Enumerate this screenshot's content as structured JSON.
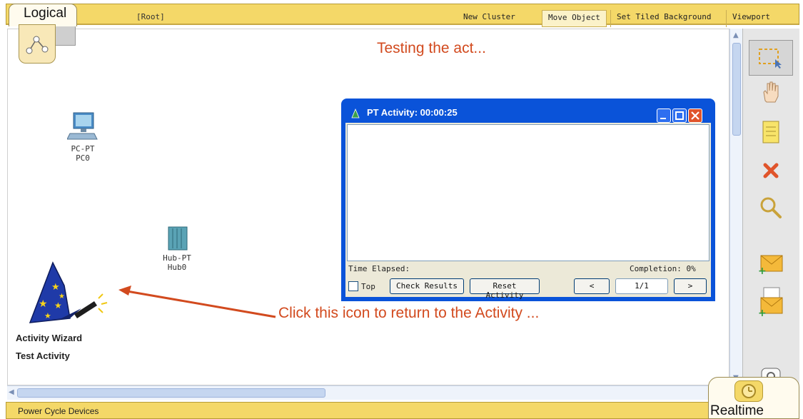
{
  "topbar": {
    "mode_tab": "Logical",
    "root": "[Root]",
    "buttons": [
      "New Cluster",
      "Move Object",
      "Set Tiled Background",
      "Viewport"
    ]
  },
  "canvas": {
    "title": "Testing the act...",
    "devices": [
      {
        "type": "PC-PT",
        "name": "PC0"
      },
      {
        "type": "Hub-PT",
        "name": "Hub0"
      }
    ],
    "wizard": {
      "line1": "Activity Wizard",
      "line2": "Test Activity"
    },
    "annotation": "Click this icon to return to the Activity ..."
  },
  "activity_window": {
    "title": "PT Activity: 00:00:25",
    "time_elapsed": "Time Elapsed:",
    "completion": "Completion: 0%",
    "top_label": "Top",
    "check_results": "Check Results",
    "reset_activity": "Reset Activity",
    "prev": "<",
    "page": "1/1",
    "next": ">"
  },
  "tools": [
    "select-icon",
    "hand-icon",
    "note-icon",
    "delete-icon",
    "inspect-icon",
    "add-simple-pdu-icon",
    "add-complex-pdu-icon"
  ],
  "realtime_tab": "Realtime",
  "status": {
    "power_cycle": "Power Cycle Devices"
  },
  "colors": {
    "accent_yellow": "#f4d868",
    "annotation_red": "#d24a1e",
    "window_blue": "#0a53d9"
  }
}
